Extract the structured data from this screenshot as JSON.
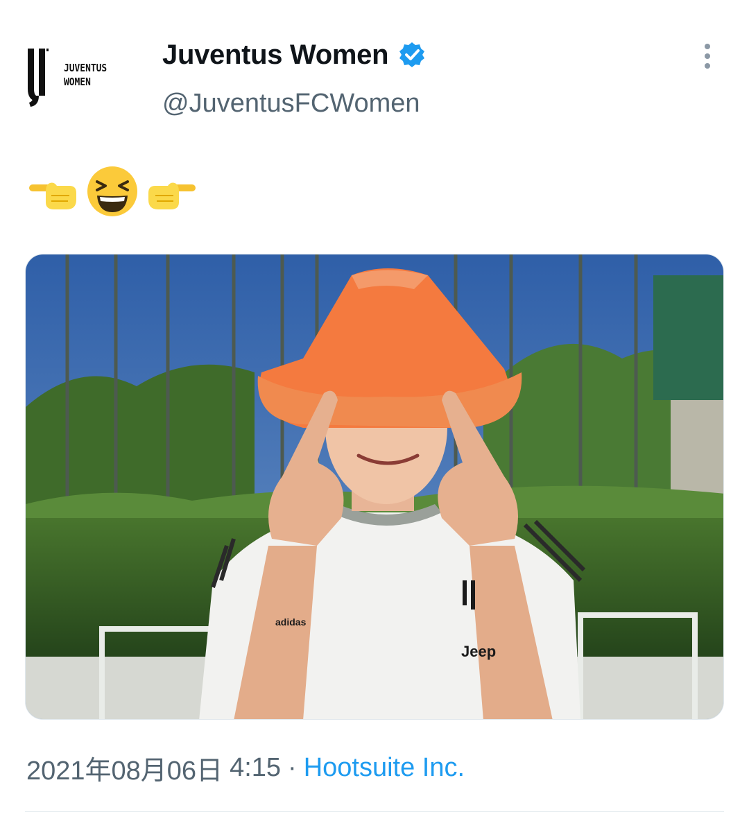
{
  "author": {
    "logo_text_line1": "JUVENTUS",
    "logo_text_line2": "WOMEN",
    "display_name": "Juventus Women",
    "verified": true,
    "handle": "@JuventusFCWomen"
  },
  "tweet": {
    "emojis": [
      "backhand-index-pointing-right",
      "grinning-squinting-face",
      "backhand-index-pointing-left"
    ],
    "media": {
      "jersey_text": "Jeep",
      "jersey_brand": "adidas"
    }
  },
  "meta": {
    "date": "2021年08月06日",
    "time": "4:15",
    "separator": "·",
    "source": "Hootsuite Inc."
  },
  "colors": {
    "verified_blue": "#1d9bf0",
    "link_blue": "#1d9bf0",
    "muted_text": "#536471",
    "cone_orange": "#f47a3f"
  }
}
